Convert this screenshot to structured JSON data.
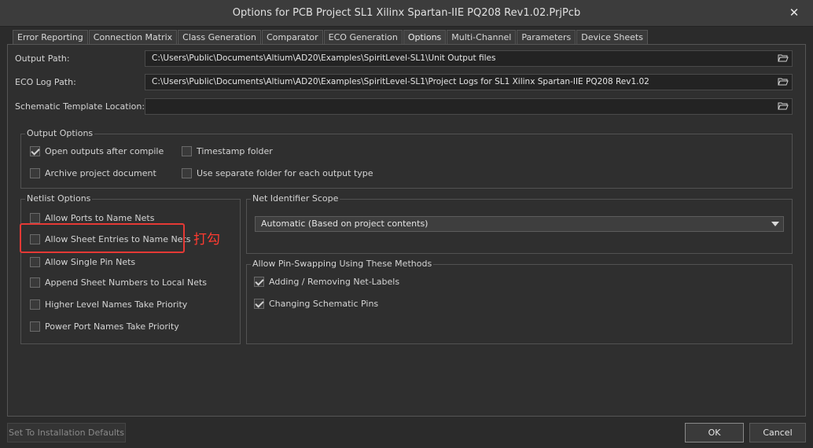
{
  "window": {
    "title": "Options for PCB Project SL1 Xilinx Spartan-IIE PQ208 Rev1.02.PrjPcb",
    "close_glyph": "✕"
  },
  "tabs": [
    {
      "label": "Error Reporting"
    },
    {
      "label": "Connection Matrix"
    },
    {
      "label": "Class Generation"
    },
    {
      "label": "Comparator"
    },
    {
      "label": "ECO Generation"
    },
    {
      "label": "Options",
      "active": true
    },
    {
      "label": "Multi-Channel"
    },
    {
      "label": "Parameters"
    },
    {
      "label": "Device Sheets"
    }
  ],
  "paths": {
    "output_path_label": "Output Path:",
    "output_path_value": "C:\\Users\\Public\\Documents\\Altium\\AD20\\Examples\\SpiritLevel-SL1\\Unit Output files",
    "eco_log_label": "ECO Log Path:",
    "eco_log_value": "C:\\Users\\Public\\Documents\\Altium\\AD20\\Examples\\SpiritLevel-SL1\\Project Logs for SL1 Xilinx Spartan-IIE PQ208 Rev1.02",
    "template_label": "Schematic Template Location:",
    "template_value": ""
  },
  "output_options": {
    "title": "Output Options",
    "items": [
      {
        "label": "Open outputs after compile",
        "checked": true
      },
      {
        "label": "Timestamp folder",
        "checked": false
      },
      {
        "label": "Archive project document",
        "checked": false
      },
      {
        "label": "Use separate folder for each output type",
        "checked": false
      }
    ]
  },
  "netlist_options": {
    "title": "Netlist Options",
    "items": [
      {
        "label": "Allow Ports to Name Nets",
        "checked": false
      },
      {
        "label": "Allow Sheet Entries to Name Nets",
        "checked": false
      },
      {
        "label": "Allow Single Pin Nets",
        "checked": false
      },
      {
        "label": "Append Sheet Numbers to Local Nets",
        "checked": false
      },
      {
        "label": "Higher Level Names Take Priority",
        "checked": false
      },
      {
        "label": "Power Port Names Take Priority",
        "checked": false
      }
    ]
  },
  "annotation": {
    "text": "打勾",
    "color": "#e53935"
  },
  "net_identifier": {
    "title": "Net Identifier Scope",
    "selected": "Automatic (Based on project contents)"
  },
  "pin_swapping": {
    "title": "Allow Pin-Swapping Using These Methods",
    "items": [
      {
        "label": "Adding / Removing Net-Labels",
        "checked": true
      },
      {
        "label": "Changing Schematic Pins",
        "checked": true
      }
    ]
  },
  "footer": {
    "defaults_label": "Set To Installation Defaults",
    "ok_label": "OK",
    "cancel_label": "Cancel"
  },
  "icons": {
    "folder": "folder-open-icon",
    "dropdown": "chevron-down-icon"
  }
}
